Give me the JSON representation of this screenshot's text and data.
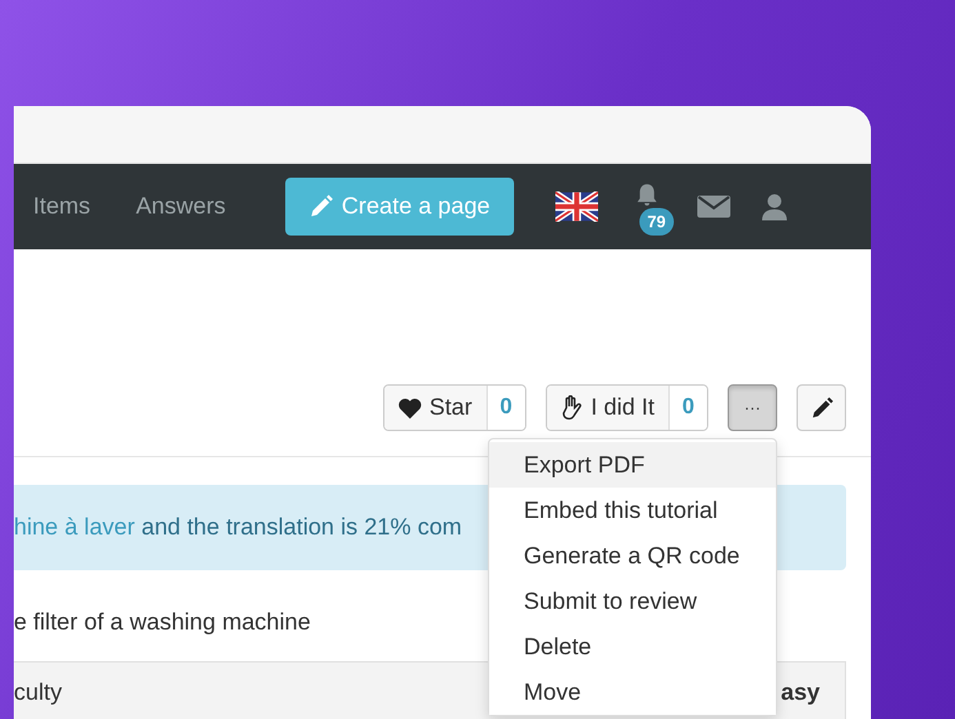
{
  "nav": {
    "links": [
      {
        "label": "Items"
      },
      {
        "label": "Answers"
      }
    ],
    "create_button": "Create a page",
    "notification_count": "79"
  },
  "actions": {
    "star": {
      "label": "Star",
      "count": "0"
    },
    "did_it": {
      "label": "I did It",
      "count": "0"
    },
    "more": {
      "label": "···",
      "expanded": true
    }
  },
  "more_menu": [
    {
      "label": "Export PDF",
      "selected": true
    },
    {
      "label": "Embed this tutorial",
      "selected": false
    },
    {
      "label": "Generate a QR code",
      "selected": false
    },
    {
      "label": "Submit to review",
      "selected": false
    },
    {
      "label": "Delete",
      "selected": false
    },
    {
      "label": "Move",
      "selected": false
    }
  ],
  "notice": {
    "link": "hine à laver",
    "text": "and the translation is 21% com"
  },
  "subtitle": "e filter of a washing machine",
  "details": [
    {
      "label": "culty",
      "value": "asy"
    }
  ]
}
